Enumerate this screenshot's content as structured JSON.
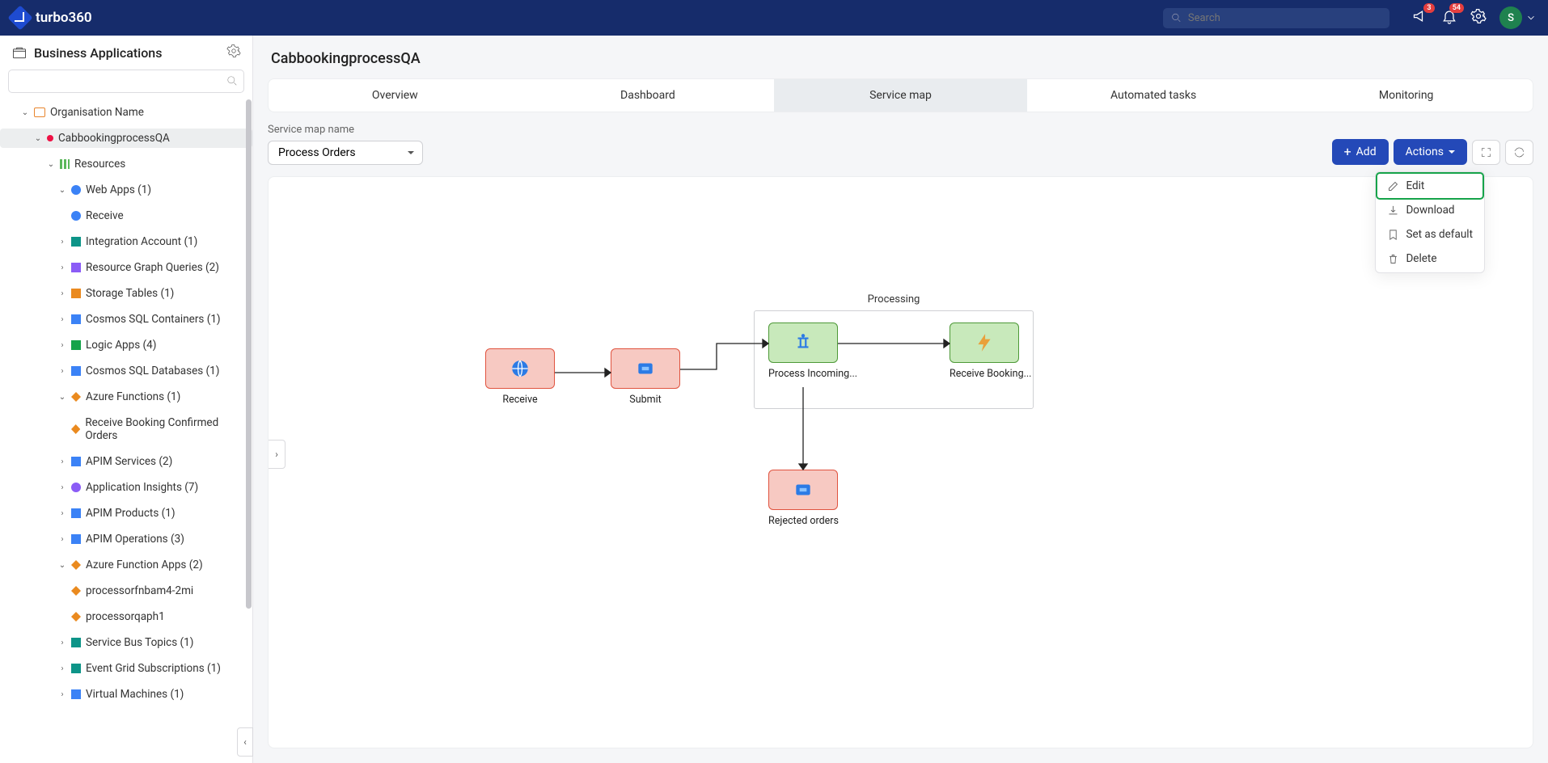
{
  "brand": "turbo360",
  "search_placeholder": "Search",
  "badges": {
    "announce": "3",
    "bell": "54"
  },
  "avatar_initial": "S",
  "sidebar": {
    "title": "Business Applications",
    "tree": {
      "org": "Organisation Name",
      "app": "CabbookingprocessQA",
      "resources_label": "Resources",
      "webapps": "Web Apps (1)",
      "webapps_child": "Receive",
      "items": [
        "Integration Account (1)",
        "Resource Graph Queries (2)",
        "Storage Tables (1)",
        "Cosmos SQL Containers (1)",
        "Logic Apps (4)",
        "Cosmos SQL Databases (1)"
      ],
      "azfn": "Azure Functions (1)",
      "azfn_child": "Receive Booking Confirmed Orders",
      "items2": [
        "APIM Services (2)",
        "Application Insights (7)",
        "APIM Products (1)",
        "APIM Operations (3)"
      ],
      "azfa": "Azure Function Apps (2)",
      "azfa_children": [
        "processorfnbam4-2mi",
        "processorqaph1"
      ],
      "items3": [
        "Service Bus Topics (1)",
        "Event Grid Subscriptions (1)",
        "Virtual Machines (1)"
      ]
    }
  },
  "page": {
    "title": "CabbookingprocessQA",
    "tabs": [
      "Overview",
      "Dashboard",
      "Service map",
      "Automated tasks",
      "Monitoring"
    ],
    "active_tab": 2,
    "service_map_label": "Service map name",
    "service_map_value": "Process Orders",
    "add_button": "Add",
    "actions_button": "Actions",
    "actions_menu": [
      "Edit",
      "Download",
      "Set as default",
      "Delete"
    ]
  },
  "diagram": {
    "group_label": "Processing",
    "nodes": {
      "receive": "Receive",
      "submit": "Submit",
      "process": "Process Incoming...",
      "booking": "Receive Booking...",
      "rejected": "Rejected orders"
    }
  }
}
